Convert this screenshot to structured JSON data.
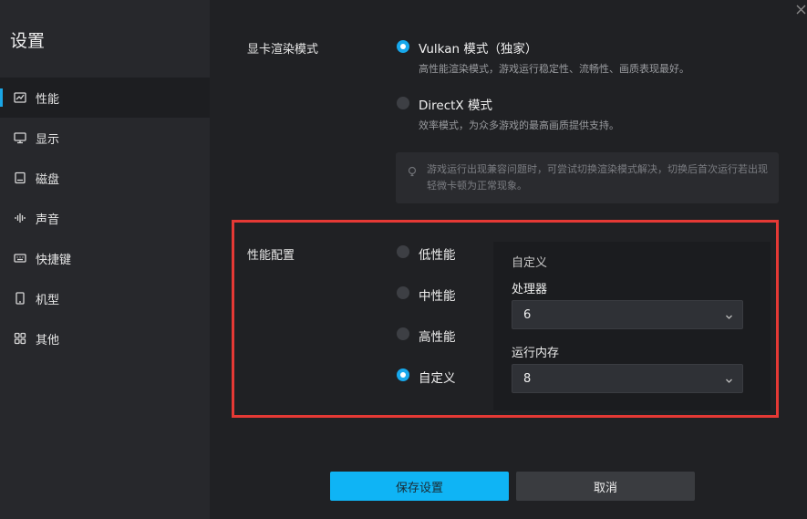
{
  "window": {
    "close_icon": "close-icon"
  },
  "sidebar": {
    "title": "设置",
    "items": [
      {
        "label": "性能",
        "icon": "chart-icon",
        "active": true
      },
      {
        "label": "显示",
        "icon": "monitor-icon"
      },
      {
        "label": "磁盘",
        "icon": "disk-icon"
      },
      {
        "label": "声音",
        "icon": "sound-icon"
      },
      {
        "label": "快捷键",
        "icon": "keyboard-icon"
      },
      {
        "label": "机型",
        "icon": "phone-icon"
      },
      {
        "label": "其他",
        "icon": "grid-icon"
      }
    ]
  },
  "render": {
    "label": "显卡渲染模式",
    "options": [
      {
        "label": "Vulkan 模式（独家）",
        "desc": "高性能渲染模式，游戏运行稳定性、流畅性、画质表现最好。",
        "checked": true
      },
      {
        "label": "DirectX 模式",
        "desc": "效率模式，为众多游戏的最高画质提供支持。",
        "checked": false
      }
    ],
    "tip": "游戏运行出现兼容问题时，可尝试切换渲染模式解决，切换后首次运行若出现轻微卡顿为正常现象。"
  },
  "performance": {
    "label": "性能配置",
    "options": [
      {
        "label": "低性能",
        "checked": false
      },
      {
        "label": "中性能",
        "checked": false
      },
      {
        "label": "高性能",
        "checked": false
      },
      {
        "label": "自定义",
        "checked": true
      }
    ],
    "custom": {
      "title": "自定义",
      "cpu_label": "处理器",
      "cpu_value": "6",
      "ram_label": "运行内存",
      "ram_value": "8"
    }
  },
  "buttons": {
    "save": "保存设置",
    "cancel": "取消"
  },
  "colors": {
    "accent": "#17a8ec",
    "highlight": "#e53935"
  }
}
